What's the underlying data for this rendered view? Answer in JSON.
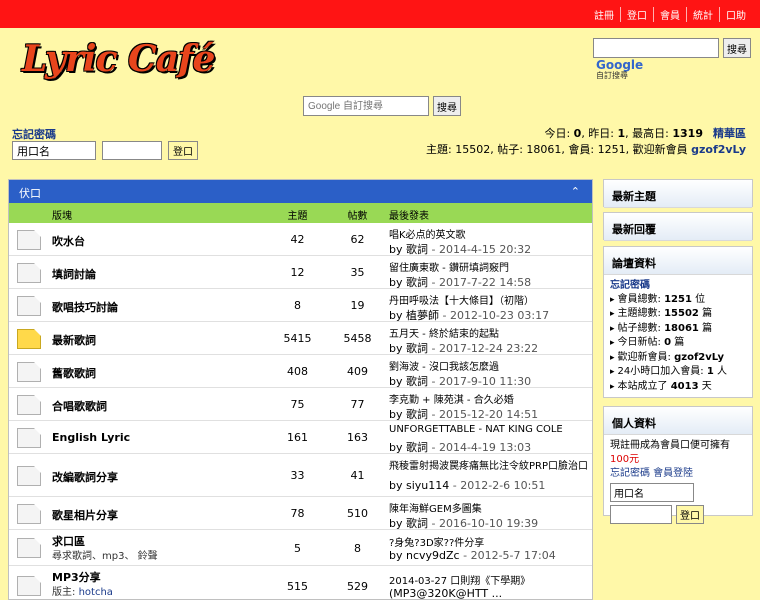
{
  "topbar": {
    "links": [
      "註冊",
      "登口",
      "會員",
      "統計",
      "口助"
    ]
  },
  "logo": "Lyric Café",
  "google_top": {
    "placeholder": "",
    "button": "搜尋",
    "brand": "Google",
    "brand_sub": "自訂搜尋"
  },
  "google_mid": {
    "placeholder": "Google 自訂搜尋",
    "button": "搜尋"
  },
  "login": {
    "forgot": "忘記密碼",
    "username_value": "用口名",
    "password_value": "",
    "button": "登口"
  },
  "stats_line1": {
    "today_label": "今日: ",
    "today": "0",
    "yesterday_label": ", 昨日: ",
    "yesterday": "1",
    "max_label": ", 最高日: ",
    "max": "1319",
    "link": "精華區"
  },
  "stats_line2": {
    "topics_label": "主題: ",
    "topics": "15502",
    "posts_label": ", 帖子: ",
    "posts": "18061",
    "members_label": ", 會員: ",
    "members": "1251",
    "newest_label": ", 歡迎新會員 ",
    "newest": "gzof2vLy"
  },
  "forum": {
    "title": "伏口",
    "caret": "⌃",
    "columns": {
      "name": "版塊",
      "topics": "主題",
      "posts": "帖數",
      "last": "最後發表"
    },
    "rows": [
      {
        "name": "吹水台",
        "desc": "",
        "desc_user": "",
        "topics": "42",
        "posts": "62",
        "last_title": "唱K必点的英文歌",
        "last_by": "by",
        "last_user": "歌詞",
        "last_time": " - 2014-4-15 20:32",
        "icon": "old"
      },
      {
        "name": "填詞討論",
        "desc": "",
        "desc_user": "",
        "topics": "12",
        "posts": "35",
        "last_title": "留住廣東歌 - 鑽研填詞竅門",
        "last_by": "by",
        "last_user": "歌詞",
        "last_time": " - 2017-7-22 14:58",
        "icon": "old"
      },
      {
        "name": "歌唱技巧討論",
        "desc": "",
        "desc_user": "",
        "topics": "8",
        "posts": "19",
        "last_title": "丹田呼吸法【十大條目】（初階）",
        "last_by": "by",
        "last_user": "植夢師",
        "last_time": " - 2012-10-23 03:17",
        "icon": "old"
      },
      {
        "name": "最新歌詞",
        "desc": "",
        "desc_user": "",
        "topics": "5415",
        "posts": "5458",
        "last_title": "五月天 - 終於結束的起點",
        "last_by": "by",
        "last_user": "歌詞",
        "last_time": " - 2017-12-24 23:22",
        "icon": "new"
      },
      {
        "name": "舊歌歌詞",
        "desc": "",
        "desc_user": "",
        "topics": "408",
        "posts": "409",
        "last_title": "劉海波 - 沒口我該怎麼過",
        "last_by": "by",
        "last_user": "歌詞",
        "last_time": " - 2017-9-10 11:30",
        "icon": "old"
      },
      {
        "name": "合唱歌歌詞",
        "desc": "",
        "desc_user": "",
        "topics": "75",
        "posts": "77",
        "last_title": "李克勤 + 陳苑淇 - 合久必婚",
        "last_by": "by",
        "last_user": "歌詞",
        "last_time": " - 2015-12-20 14:51",
        "icon": "old"
      },
      {
        "name": "English Lyric",
        "desc": "",
        "desc_user": "",
        "topics": "161",
        "posts": "163",
        "last_title": "UNFORGETTABLE - NAT KING COLE",
        "last_by": "by",
        "last_user": "歌詞",
        "last_time": " - 2014-4-19 13:03",
        "icon": "old"
      },
      {
        "name": "改編歌詞分享",
        "desc": "",
        "desc_user": "",
        "topics": "33",
        "posts": "41",
        "last_title": "飛稜雷射揭波罠疼痛無比注令紋PRP口臉治口",
        "last_by": "by",
        "last_user": "siyu114",
        "last_time": " - 2012-2-6 10:51",
        "icon": "old"
      },
      {
        "name": "歌星相片分享",
        "desc": "",
        "desc_user": "",
        "topics": "78",
        "posts": "510",
        "last_title": "陳年海鮮GEM多圖集",
        "last_by": "by",
        "last_user": "歌詞",
        "last_time": " - 2016-10-10 19:39",
        "icon": "old"
      },
      {
        "name": "求口區",
        "desc": "尋求歌詞、mp3、 鈴聲",
        "desc_user": "",
        "topics": "5",
        "posts": "8",
        "last_title": "?身兔?3D家??件分享",
        "last_by": "by",
        "last_user": "ncvy9dZc",
        "last_time": " - 2012-5-7 17:04",
        "icon": "old"
      },
      {
        "name": "MP3分享",
        "desc": "版主: ",
        "desc_user": "hotcha",
        "topics": "515",
        "posts": "529",
        "last_title": "2014-03-27 口則翔《下學期》",
        "last_by": "",
        "last_user": "(MP3@320K@HTT ...",
        "last_time": "",
        "icon": "old"
      }
    ]
  },
  "side": {
    "hot": "最新主題",
    "newreply": "最新回覆",
    "stats_title": "論壇資料",
    "stats_link": "忘記密碼",
    "stats_items": [
      {
        "label": "會員總數: ",
        "value": "1251",
        "unit": " 位"
      },
      {
        "label": "主題總數: ",
        "value": "15502",
        "unit": " 篇"
      },
      {
        "label": "帖子總數: ",
        "value": "18061",
        "unit": " 篇"
      },
      {
        "label": "今日新帖: ",
        "value": "0",
        "unit": " 篇"
      },
      {
        "label": "歡迎新會員: ",
        "value": "gzof2vLy",
        "unit": ""
      },
      {
        "label": "24小時口加入會員: ",
        "value": "1",
        "unit": " 人"
      },
      {
        "label": "本站成立了 ",
        "value": "4013",
        "unit": " 天"
      }
    ],
    "user_title": "個人資料",
    "user_text1": "現註冊成為會員口便可擁有",
    "user_money": "100元",
    "user_link1": "忘記密碼",
    "user_link2": " 會員登陸",
    "user_field": "用口名",
    "user_button": "登口"
  }
}
